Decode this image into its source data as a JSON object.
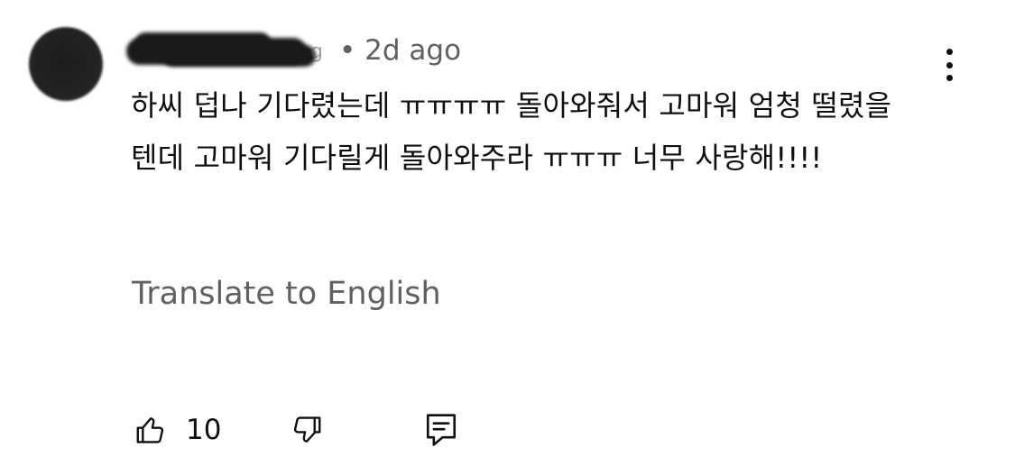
{
  "comment": {
    "author_fragment": "g",
    "meta": "• 2d ago",
    "text": "하씨 덥나 기다렸는데 ㅠㅠㅠㅠ 돌아와줘서 고마워 엄청 떨렸을 텐데 고마워 기다릴게 돌아와주라 ㅠㅠㅠ 너무 사랑해!!!!",
    "translate_label": "Translate to English",
    "like_count": "10"
  },
  "icons": {
    "more": "more-vertical-icon",
    "like": "thumbs-up-icon",
    "dislike": "thumbs-down-icon",
    "reply": "reply-comment-icon"
  },
  "colors": {
    "text": "#0f0f0f",
    "secondary": "#606060",
    "background": "#ffffff"
  }
}
